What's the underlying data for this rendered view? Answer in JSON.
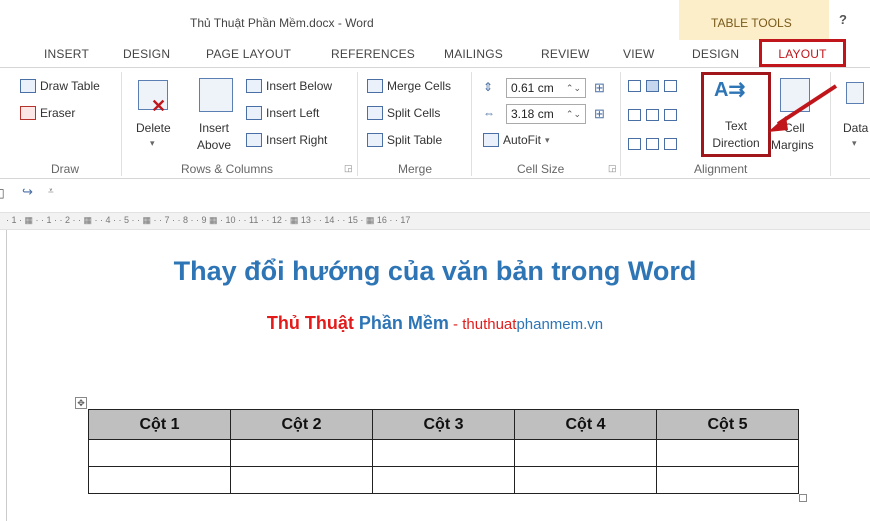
{
  "window": {
    "title": "Thủ Thuật Phần Mềm.docx - Word",
    "contextual_group": "TABLE TOOLS",
    "help": "?"
  },
  "tabs": [
    {
      "label": "INSERT"
    },
    {
      "label": "DESIGN"
    },
    {
      "label": "PAGE LAYOUT"
    },
    {
      "label": "REFERENCES"
    },
    {
      "label": "MAILINGS"
    },
    {
      "label": "REVIEW"
    },
    {
      "label": "VIEW"
    },
    {
      "label": "DESIGN"
    },
    {
      "label": "LAYOUT"
    }
  ],
  "ribbon": {
    "draw": {
      "label": "Draw",
      "draw_table": "Draw Table",
      "eraser": "Eraser"
    },
    "rows_columns": {
      "label": "Rows & Columns",
      "delete": "Delete",
      "insert_above_1": "Insert",
      "insert_above_2": "Above",
      "insert_below": "Insert Below",
      "insert_left": "Insert Left",
      "insert_right": "Insert Right"
    },
    "merge": {
      "label": "Merge",
      "merge_cells": "Merge Cells",
      "split_cells": "Split Cells",
      "split_table": "Split Table"
    },
    "cell_size": {
      "label": "Cell Size",
      "height": "0.61 cm",
      "width": "3.18 cm",
      "autofit": "AutoFit"
    },
    "alignment": {
      "label": "Alignment",
      "text_direction_1": "Text",
      "text_direction_2": "Direction",
      "cell_margins_1": "Cell",
      "cell_margins_2": "Margins"
    },
    "data": {
      "label": "Data"
    }
  },
  "ruler": "· 1 · ▦ · · 1 · · 2 · · ▦ · · 4 · · 5 · · ▦ · · 7 · · 8 · · 9 ▦ · 10 · · 11 · · 12 · ▦ 13 · · 14 · · 15 · ▦ 16 · · 17",
  "document": {
    "title": "Thay đổi hướng của văn bản trong Word",
    "subtitle_red": "Thủ Thuật",
    "subtitle_blue": "Phần Mềm",
    "subtitle_dash": " - ",
    "site_red": "thuthuat",
    "site_blue": "phanmem.vn",
    "table_headers": [
      "Cột 1",
      "Cột 2",
      "Cột 3",
      "Cột 4",
      "Cột 5"
    ]
  },
  "colors": {
    "highlight_red": "#c0161b",
    "title_blue": "#2e75b6",
    "contextual_tab_bg": "#fbeec9"
  }
}
